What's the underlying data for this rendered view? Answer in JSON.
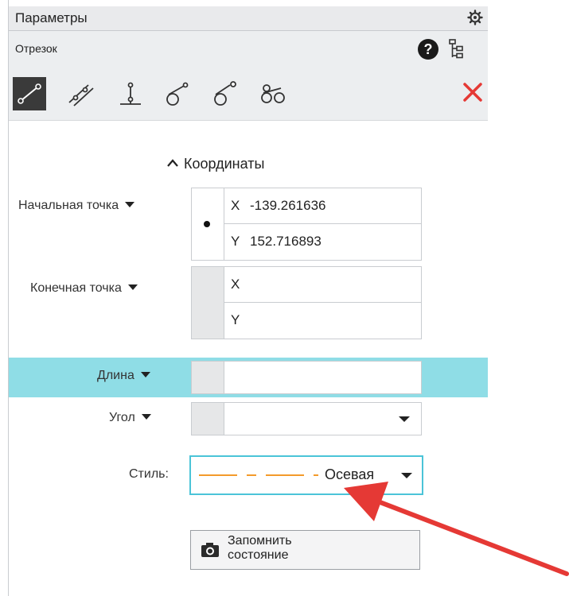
{
  "panel": {
    "title": "Параметры",
    "object_name": "Отрезок",
    "close_color": "#e53935"
  },
  "toolbar": {
    "tools": [
      "line-two-points-icon",
      "line-parallel-icon",
      "line-perpendicular-icon",
      "line-tangent-icon",
      "line-tangent-two-curves-icon",
      "line-two-curves-icon"
    ],
    "active_tool": "line-two-points-icon"
  },
  "section": {
    "label": "Координаты"
  },
  "start_point": {
    "label": "Начальная точка",
    "x_axis": "X",
    "y_axis": "Y",
    "x": "-139.261636",
    "y": "152.716893"
  },
  "end_point": {
    "label": "Конечная точка",
    "x_axis": "X",
    "y_axis": "Y",
    "x": "",
    "y": ""
  },
  "length": {
    "label": "Длина",
    "value": ""
  },
  "angle": {
    "label": "Угол",
    "value": ""
  },
  "style": {
    "label": "Стиль:",
    "value": "Осевая",
    "line_color": "#f39a2b"
  },
  "remember": {
    "line1": "Запомнить",
    "line2": "состояние"
  },
  "annotation": {
    "arrow_color": "#e53935"
  },
  "colors": {
    "highlight": "#8fdde6",
    "focus_border": "#4bc4d8"
  }
}
